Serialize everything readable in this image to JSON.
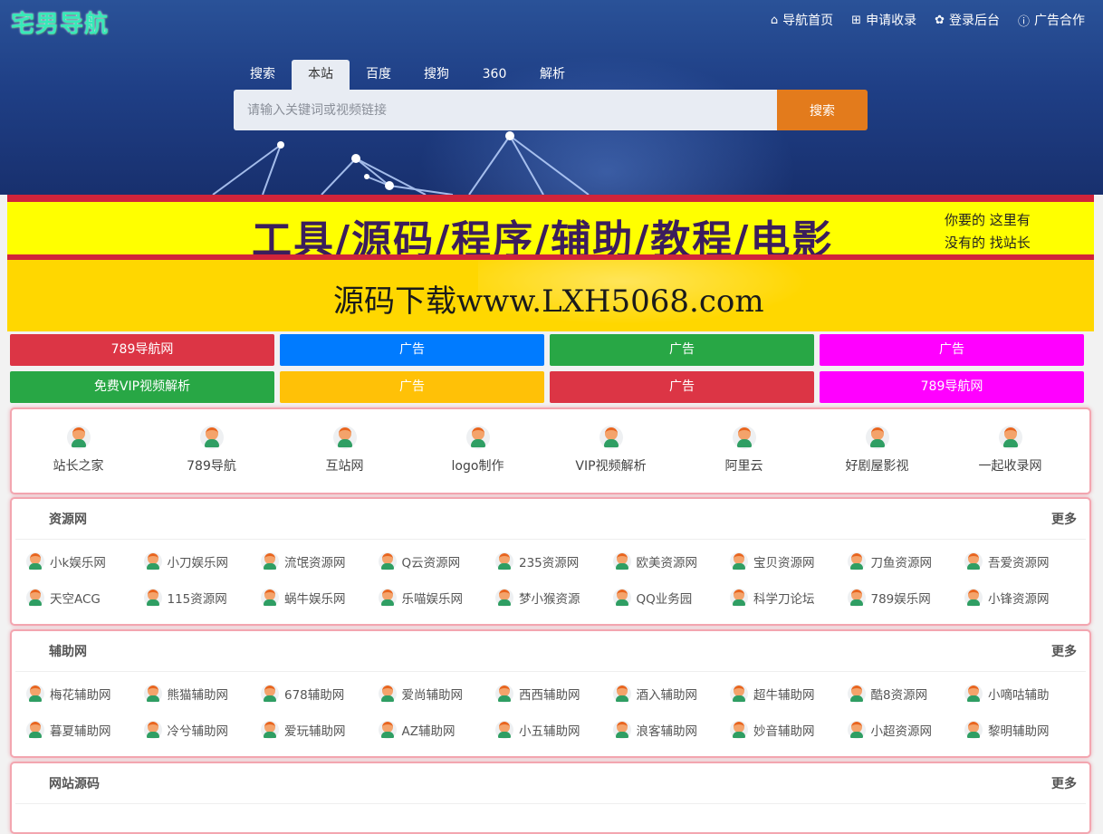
{
  "logo": "宅男导航",
  "topnav": [
    {
      "icon": "home-icon",
      "glyph": "⌂",
      "label": "导航首页"
    },
    {
      "icon": "plus-square-icon",
      "glyph": "⊞",
      "label": "申请收录"
    },
    {
      "icon": "paw-icon",
      "glyph": "✿",
      "label": "登录后台"
    },
    {
      "icon": "info-circle-icon",
      "glyph": "ⓘ",
      "label": "广告合作"
    }
  ],
  "search": {
    "tabs": [
      "搜索",
      "本站",
      "百度",
      "搜狗",
      "360",
      "解析"
    ],
    "active_tab": "本站",
    "placeholder": "请输入关键词或视频链接",
    "button": "搜索"
  },
  "banner1": {
    "headline": "工具/源码/程序/辅助/教程/电影",
    "side_line1": "你要的 这里有",
    "side_line2": "没有的 找站长"
  },
  "banner2": {
    "text": "源码下载www.LXH5068.com"
  },
  "ad_buttons": [
    {
      "label": "789导航网",
      "color": "#dc3545"
    },
    {
      "label": "广告",
      "color": "#007bff"
    },
    {
      "label": "广告",
      "color": "#28a745"
    },
    {
      "label": "广告",
      "color": "#ff00ff"
    },
    {
      "label": "免费VIP视频解析",
      "color": "#28a745"
    },
    {
      "label": "广告",
      "color": "#ffc107"
    },
    {
      "label": "广告",
      "color": "#dc3545"
    },
    {
      "label": "789导航网",
      "color": "#ff00ff"
    }
  ],
  "quick_links": [
    "站长之家",
    "789导航",
    "互站网",
    "logo制作",
    "VIP视频解析",
    "阿里云",
    "好剧屋影视",
    "一起收录网"
  ],
  "categories": [
    {
      "title": "资源网",
      "more": "更多",
      "links": [
        "小k娱乐网",
        "小刀娱乐网",
        "流氓资源网",
        "Q云资源网",
        "235资源网",
        "欧美资源网",
        "宝贝资源网",
        "刀鱼资源网",
        "吾爱资源网",
        "天空ACG",
        "115资源网",
        "蜗牛娱乐网",
        "乐喵娱乐网",
        "梦小猴资源",
        "QQ业务园",
        "科学刀论坛",
        "789娱乐网",
        "小锋资源网"
      ]
    },
    {
      "title": "辅助网",
      "more": "更多",
      "links": [
        "梅花辅助网",
        "熊猫辅助网",
        "678辅助网",
        "爱尚辅助网",
        "西西辅助网",
        "酒入辅助网",
        "超牛辅助网",
        "酷8资源网",
        "小嘀咕辅助",
        "暮夏辅助网",
        "冷兮辅助网",
        "爱玩辅助网",
        "AZ辅助网",
        "小五辅助网",
        "浪客辅助网",
        "妙音辅助网",
        "小超资源网",
        "黎明辅助网"
      ]
    },
    {
      "title": "网站源码",
      "more": "更多",
      "links": []
    }
  ]
}
